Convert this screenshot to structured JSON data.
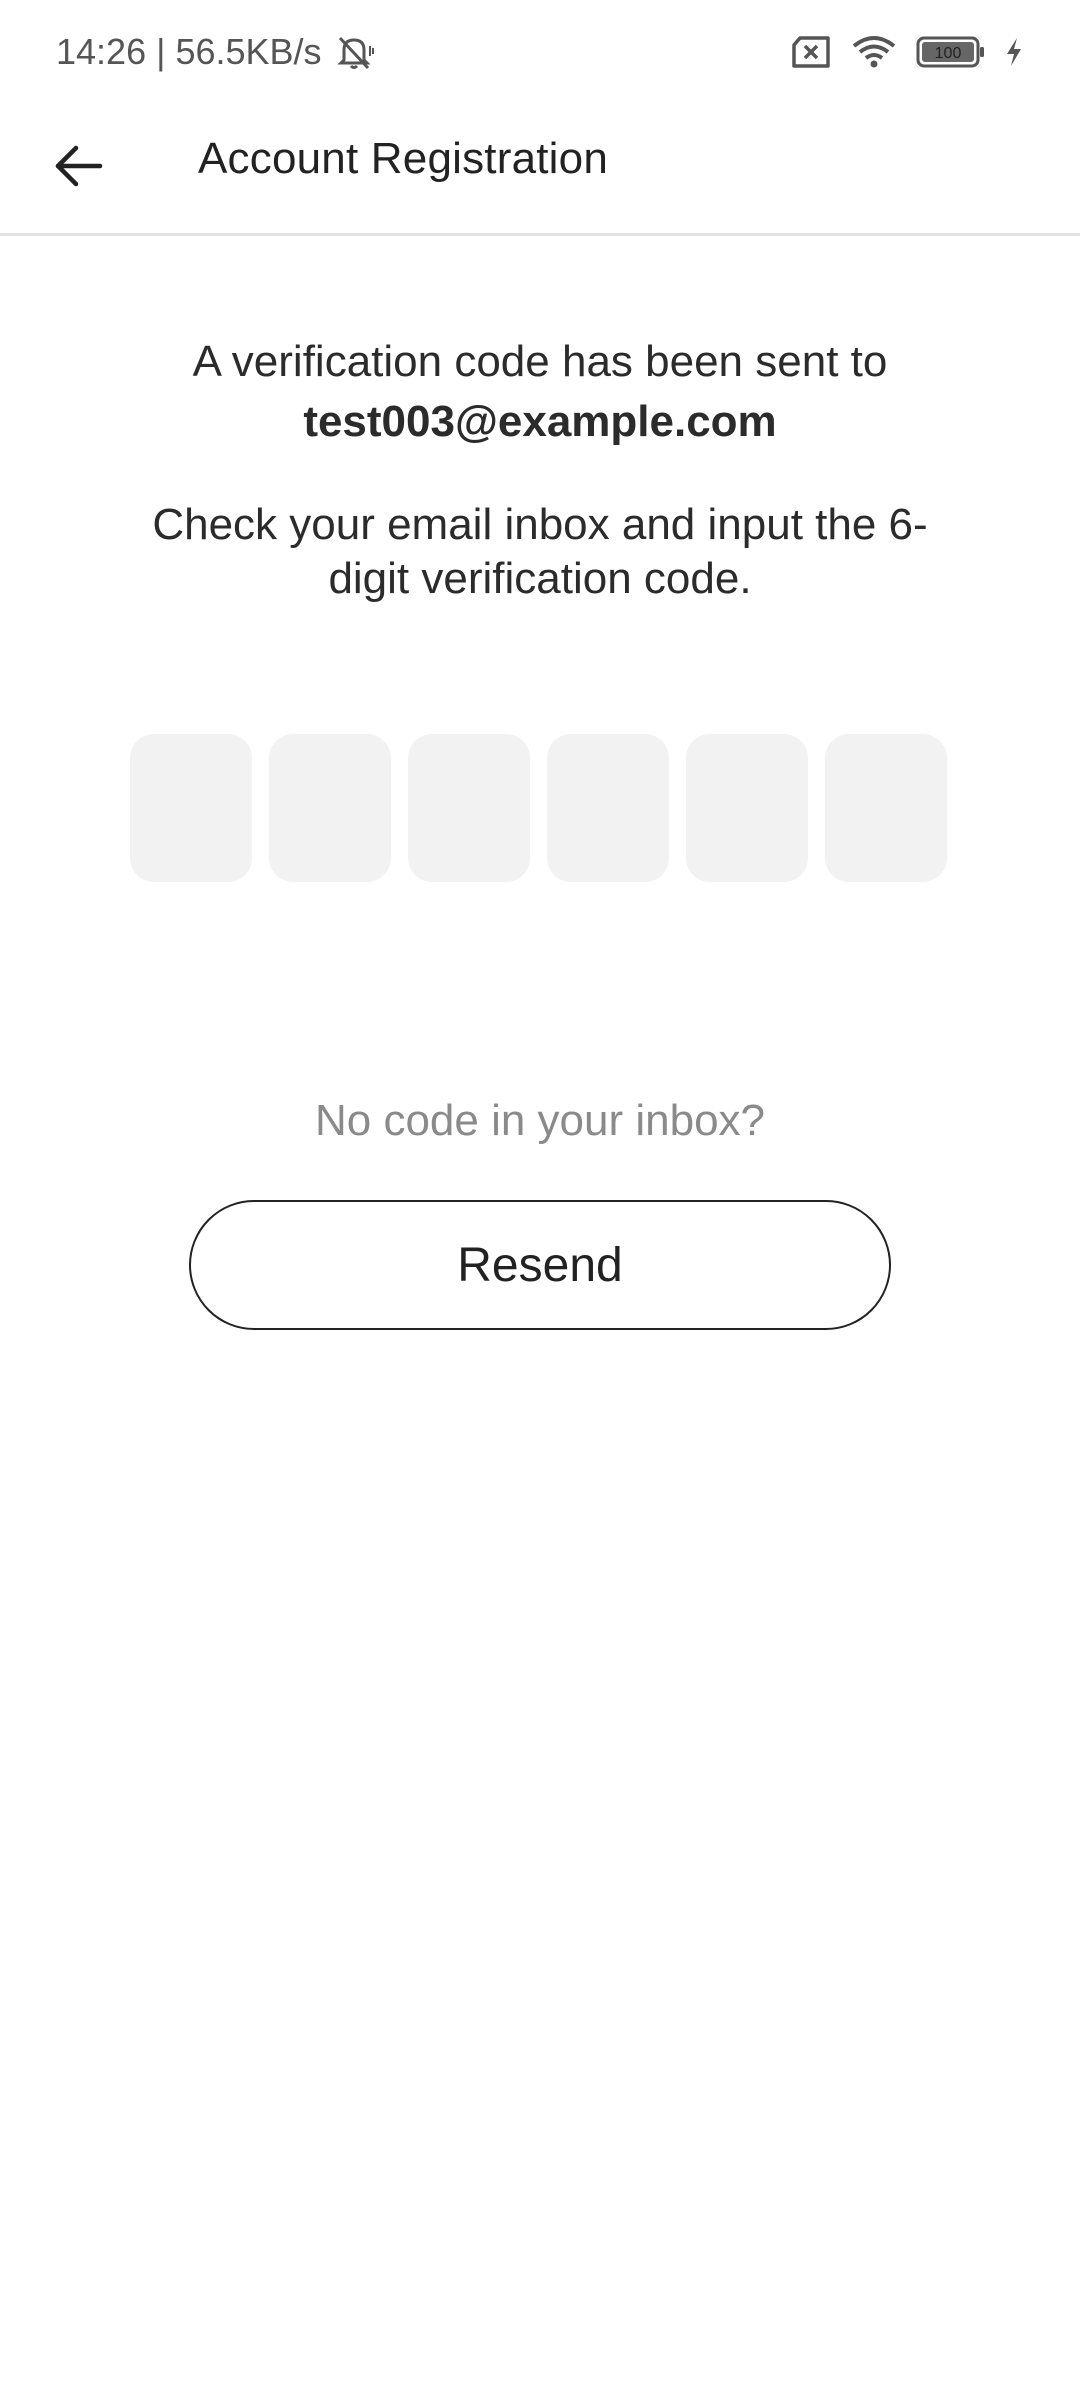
{
  "status_bar": {
    "time": "14:26",
    "separator": "|",
    "net_speed": "56.5KB/s",
    "icons": [
      "bell-muted-icon",
      "sim-none-icon",
      "wifi-icon",
      "battery-icon",
      "charging-icon"
    ],
    "battery_level": "100"
  },
  "app_bar": {
    "back_icon": "arrow-left-icon",
    "title": "Account Registration"
  },
  "main": {
    "sent_text": "A verification code has been sent to",
    "email": "test003@example.com",
    "instructions": "Check your email inbox and input the 6-digit verification code.",
    "code_length": 6,
    "no_code_text": "No code in your inbox?",
    "resend_label": "Resend"
  },
  "colors": {
    "background": "#ffffff",
    "text": "#222222",
    "muted_text": "#8a8a8a",
    "code_box_bg": "#f2f2f2",
    "divider": "#e3e3e3"
  }
}
